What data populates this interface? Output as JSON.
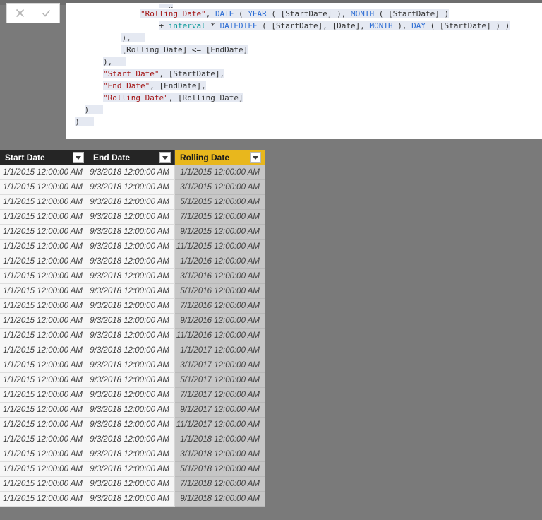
{
  "window": {
    "background_color": "#7a7a7a"
  },
  "formula_bar": {
    "cancel_label": "X",
    "cancel_icon": "close-icon",
    "commit_label": "✓",
    "commit_icon": "checkmark-icon"
  },
  "editor": {
    "selection_color": "#e5e9f2",
    "string_color": "#a31515",
    "function_color": "#2b6cd4",
    "variable_color": "#0f9b9b",
    "lines": [
      {
        "clipped": true,
        "indent": "                    ",
        "tokens": [
          {
            "t": ", ",
            "c": "plain"
          },
          {
            "t": "x",
            "c": "plain"
          }
        ]
      },
      {
        "indent": "                ",
        "tokens": [
          {
            "t": "\"Rolling Date\"",
            "c": "str"
          },
          {
            "t": ", ",
            "c": "plain"
          },
          {
            "t": "DATE",
            "c": "fn"
          },
          {
            "t": " ( ",
            "c": "plain"
          },
          {
            "t": "YEAR",
            "c": "fn"
          },
          {
            "t": " ( [StartDate] ), ",
            "c": "plain"
          },
          {
            "t": "MONTH",
            "c": "fn"
          },
          {
            "t": " ( [StartDate] )",
            "c": "plain"
          }
        ]
      },
      {
        "indent": "                    ",
        "tokens": [
          {
            "t": "+ ",
            "c": "plain"
          },
          {
            "t": "interval",
            "c": "var"
          },
          {
            "t": " * ",
            "c": "plain"
          },
          {
            "t": "DATEDIFF",
            "c": "fn"
          },
          {
            "t": " ( [StartDate], [Date], ",
            "c": "plain"
          },
          {
            "t": "MONTH",
            "c": "fn"
          },
          {
            "t": " ), ",
            "c": "plain"
          },
          {
            "t": "DAY",
            "c": "fn"
          },
          {
            "t": " ( [StartDate] ) )",
            "c": "plain"
          }
        ]
      },
      {
        "indent": "            ",
        "tokens": [
          {
            "t": "),",
            "c": "plain"
          },
          {
            "t": "   ",
            "c": "plain"
          }
        ]
      },
      {
        "indent": "            ",
        "tokens": [
          {
            "t": "[Rolling Date] <= [EndDate]",
            "c": "plain"
          }
        ]
      },
      {
        "indent": "        ",
        "tokens": [
          {
            "t": "),",
            "c": "plain"
          },
          {
            "t": "   ",
            "c": "plain"
          }
        ]
      },
      {
        "indent": "        ",
        "tokens": [
          {
            "t": "\"Start Date\"",
            "c": "str"
          },
          {
            "t": ", [StartDate],",
            "c": "plain"
          }
        ]
      },
      {
        "indent": "        ",
        "tokens": [
          {
            "t": "\"End Date\"",
            "c": "str"
          },
          {
            "t": ", [EndDate],",
            "c": "plain"
          }
        ]
      },
      {
        "indent": "        ",
        "tokens": [
          {
            "t": "\"Rolling Date\"",
            "c": "str"
          },
          {
            "t": ", [Rolling Date]",
            "c": "plain"
          }
        ]
      },
      {
        "indent": "    ",
        "tokens": [
          {
            "t": ")",
            "c": "plain"
          },
          {
            "t": "   ",
            "c": "plain"
          }
        ]
      },
      {
        "indent": "  ",
        "tokens": [
          {
            "t": ")",
            "c": "plain"
          },
          {
            "t": "   ",
            "c": "plain"
          }
        ]
      }
    ]
  },
  "table": {
    "columns": [
      {
        "label": "Start Date",
        "highlighted": false,
        "caret_icon": "chevron-down-icon"
      },
      {
        "label": "End Date",
        "highlighted": false,
        "caret_icon": "chevron-down-icon"
      },
      {
        "label": "Rolling Date",
        "highlighted": true,
        "caret_icon": "chevron-down-icon",
        "header_color": "#e8b71d"
      }
    ],
    "rows": [
      [
        "1/1/2015 12:00:00 AM",
        "9/3/2018 12:00:00 AM",
        "1/1/2015 12:00:00 AM"
      ],
      [
        "1/1/2015 12:00:00 AM",
        "9/3/2018 12:00:00 AM",
        "3/1/2015 12:00:00 AM"
      ],
      [
        "1/1/2015 12:00:00 AM",
        "9/3/2018 12:00:00 AM",
        "5/1/2015 12:00:00 AM"
      ],
      [
        "1/1/2015 12:00:00 AM",
        "9/3/2018 12:00:00 AM",
        "7/1/2015 12:00:00 AM"
      ],
      [
        "1/1/2015 12:00:00 AM",
        "9/3/2018 12:00:00 AM",
        "9/1/2015 12:00:00 AM"
      ],
      [
        "1/1/2015 12:00:00 AM",
        "9/3/2018 12:00:00 AM",
        "11/1/2015 12:00:00 AM"
      ],
      [
        "1/1/2015 12:00:00 AM",
        "9/3/2018 12:00:00 AM",
        "1/1/2016 12:00:00 AM"
      ],
      [
        "1/1/2015 12:00:00 AM",
        "9/3/2018 12:00:00 AM",
        "3/1/2016 12:00:00 AM"
      ],
      [
        "1/1/2015 12:00:00 AM",
        "9/3/2018 12:00:00 AM",
        "5/1/2016 12:00:00 AM"
      ],
      [
        "1/1/2015 12:00:00 AM",
        "9/3/2018 12:00:00 AM",
        "7/1/2016 12:00:00 AM"
      ],
      [
        "1/1/2015 12:00:00 AM",
        "9/3/2018 12:00:00 AM",
        "9/1/2016 12:00:00 AM"
      ],
      [
        "1/1/2015 12:00:00 AM",
        "9/3/2018 12:00:00 AM",
        "11/1/2016 12:00:00 AM"
      ],
      [
        "1/1/2015 12:00:00 AM",
        "9/3/2018 12:00:00 AM",
        "1/1/2017 12:00:00 AM"
      ],
      [
        "1/1/2015 12:00:00 AM",
        "9/3/2018 12:00:00 AM",
        "3/1/2017 12:00:00 AM"
      ],
      [
        "1/1/2015 12:00:00 AM",
        "9/3/2018 12:00:00 AM",
        "5/1/2017 12:00:00 AM"
      ],
      [
        "1/1/2015 12:00:00 AM",
        "9/3/2018 12:00:00 AM",
        "7/1/2017 12:00:00 AM"
      ],
      [
        "1/1/2015 12:00:00 AM",
        "9/3/2018 12:00:00 AM",
        "9/1/2017 12:00:00 AM"
      ],
      [
        "1/1/2015 12:00:00 AM",
        "9/3/2018 12:00:00 AM",
        "11/1/2017 12:00:00 AM"
      ],
      [
        "1/1/2015 12:00:00 AM",
        "9/3/2018 12:00:00 AM",
        "1/1/2018 12:00:00 AM"
      ],
      [
        "1/1/2015 12:00:00 AM",
        "9/3/2018 12:00:00 AM",
        "3/1/2018 12:00:00 AM"
      ],
      [
        "1/1/2015 12:00:00 AM",
        "9/3/2018 12:00:00 AM",
        "5/1/2018 12:00:00 AM"
      ],
      [
        "1/1/2015 12:00:00 AM",
        "9/3/2018 12:00:00 AM",
        "7/1/2018 12:00:00 AM"
      ],
      [
        "1/1/2015 12:00:00 AM",
        "9/3/2018 12:00:00 AM",
        "9/1/2018 12:00:00 AM"
      ]
    ]
  }
}
